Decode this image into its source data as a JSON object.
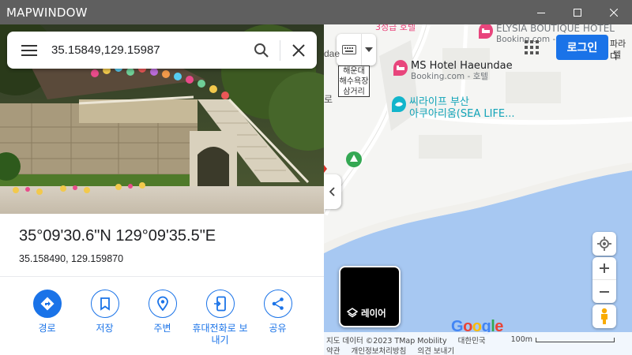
{
  "window": {
    "title": "MAPWINDOW",
    "controls": [
      "minimize",
      "maximize",
      "close"
    ]
  },
  "search": {
    "query": "35.15849,129.15987",
    "menu_icon": "hamburger-menu-icon",
    "search_icon": "search-icon",
    "clear_icon": "close-icon"
  },
  "place": {
    "title": "35°09'30.6\"N 129°09'35.5\"E",
    "decimal": "35.158490, 129.159870"
  },
  "actions": [
    {
      "label": "경로",
      "icon": "directions-icon"
    },
    {
      "label": "저장",
      "icon": "bookmark-icon"
    },
    {
      "label": "주변",
      "icon": "nearby-icon"
    },
    {
      "label": "휴대전화로 보내기",
      "icon": "send-to-phone-icon"
    },
    {
      "label": "공유",
      "icon": "share-icon"
    }
  ],
  "map": {
    "pois": [
      {
        "name": "MS Hotel Haeundae",
        "sub": "Booking.com - 호텔"
      },
      {
        "name": "ELYSIA BOUTIQUE HOTEL",
        "sub": "Booking.com - 호텔"
      },
      {
        "name": "씨라이프 부산",
        "sub": "아쿠아리움(SEA LIFE..."
      },
      {
        "name": "3성급 호텔",
        "sub": ""
      }
    ],
    "bus_stop": [
      "해운대",
      "해수욕장",
      "삼거리"
    ],
    "edge_labels": [
      "dae",
      "로",
      "파라다",
      "텔"
    ],
    "login_label": "로그인",
    "layer_label": "레이어",
    "logo": "Google",
    "footer_row1": [
      "지도 데이터 ©2023 TMap Mobility",
      "대한민국"
    ],
    "footer_row2": [
      "약관",
      "개인정보처리방침",
      "의견 보내기"
    ],
    "scale_label": "100m",
    "colors": {
      "water": "#a7c8f2",
      "land": "#f5f5f3",
      "accent": "#1a73e8",
      "hotel_pin": "#e8457c",
      "aquarium_pin": "#12b5cb",
      "park_pin": "#34a853"
    }
  }
}
